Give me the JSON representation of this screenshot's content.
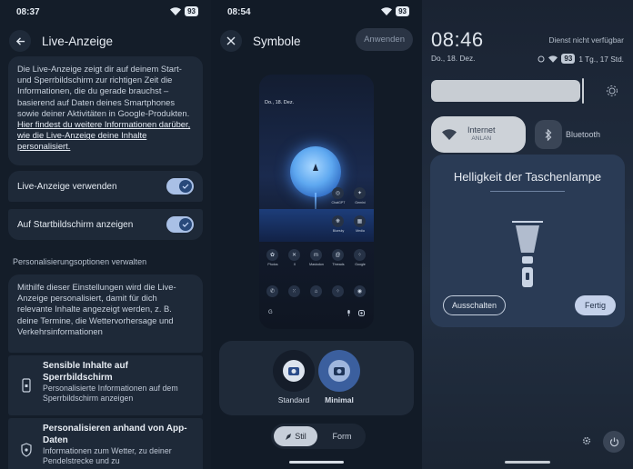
{
  "left": {
    "status_time": "08:37",
    "battery": "93",
    "title": "Live-Anzeige",
    "desc_text": "Die Live-Anzeige zeigt dir auf deinem Start- und Sperrbildschirm zur richtigen Zeit die Informationen, die du gerade brauchst – basierend auf Daten deines Smartphones sowie deiner Aktivitäten in Google-Produkten.",
    "desc_link": "Hier findest du weitere Informationen darüber, wie die Live-Anzeige deine Inhalte personalisiert.",
    "toggle1": "Live-Anzeige verwenden",
    "toggle2": "Auf Startbildschirm anzeigen",
    "section": "Personalisierungsoptionen verwalten",
    "info": "Mithilfe dieser Einstellungen wird die Live-Anzeige personalisiert, damit für dich relevante Inhalte angezeigt werden, z. B. deine Termine, die Wettervorhersage und Verkehrsinformationen",
    "opt1_title": "Sensible Inhalte auf Sperrbildschirm",
    "opt1_sub": "Personalisierte Informationen auf dem Sperrbildschirm anzeigen",
    "opt2_title": "Personalisieren anhand von App-Daten",
    "opt2_sub": "Informationen zum Wetter, zu deiner Pendelstrecke und zu"
  },
  "middle": {
    "status_time": "08:54",
    "battery": "93",
    "title": "Symbole",
    "apply": "Anwenden",
    "preview_date": "Do., 18. Dez.",
    "apps_row1": [
      "ChatGPT",
      "Gemini"
    ],
    "apps_row2": [
      "Bluesky",
      "Media"
    ],
    "apps_row3": [
      "Photos",
      "X",
      "Mastodon",
      "Threads",
      "Google"
    ],
    "dock_g": "G",
    "style_standard": "Standard",
    "style_minimal": "Minimal",
    "seg_stil": "Stil",
    "seg_form": "Form"
  },
  "right": {
    "time": "08:46",
    "no_service": "Dienst nicht verfügbar",
    "date": "Do., 18. Dez.",
    "battery": "93",
    "battery_est": "1 Tg., 17 Std.",
    "internet": "Internet",
    "internet_sub": "ANLAN",
    "bluetooth": "Bluetooth",
    "dialog_title": "Helligkeit der Taschenlampe",
    "btn_off": "Ausschalten",
    "btn_done": "Fertig"
  }
}
